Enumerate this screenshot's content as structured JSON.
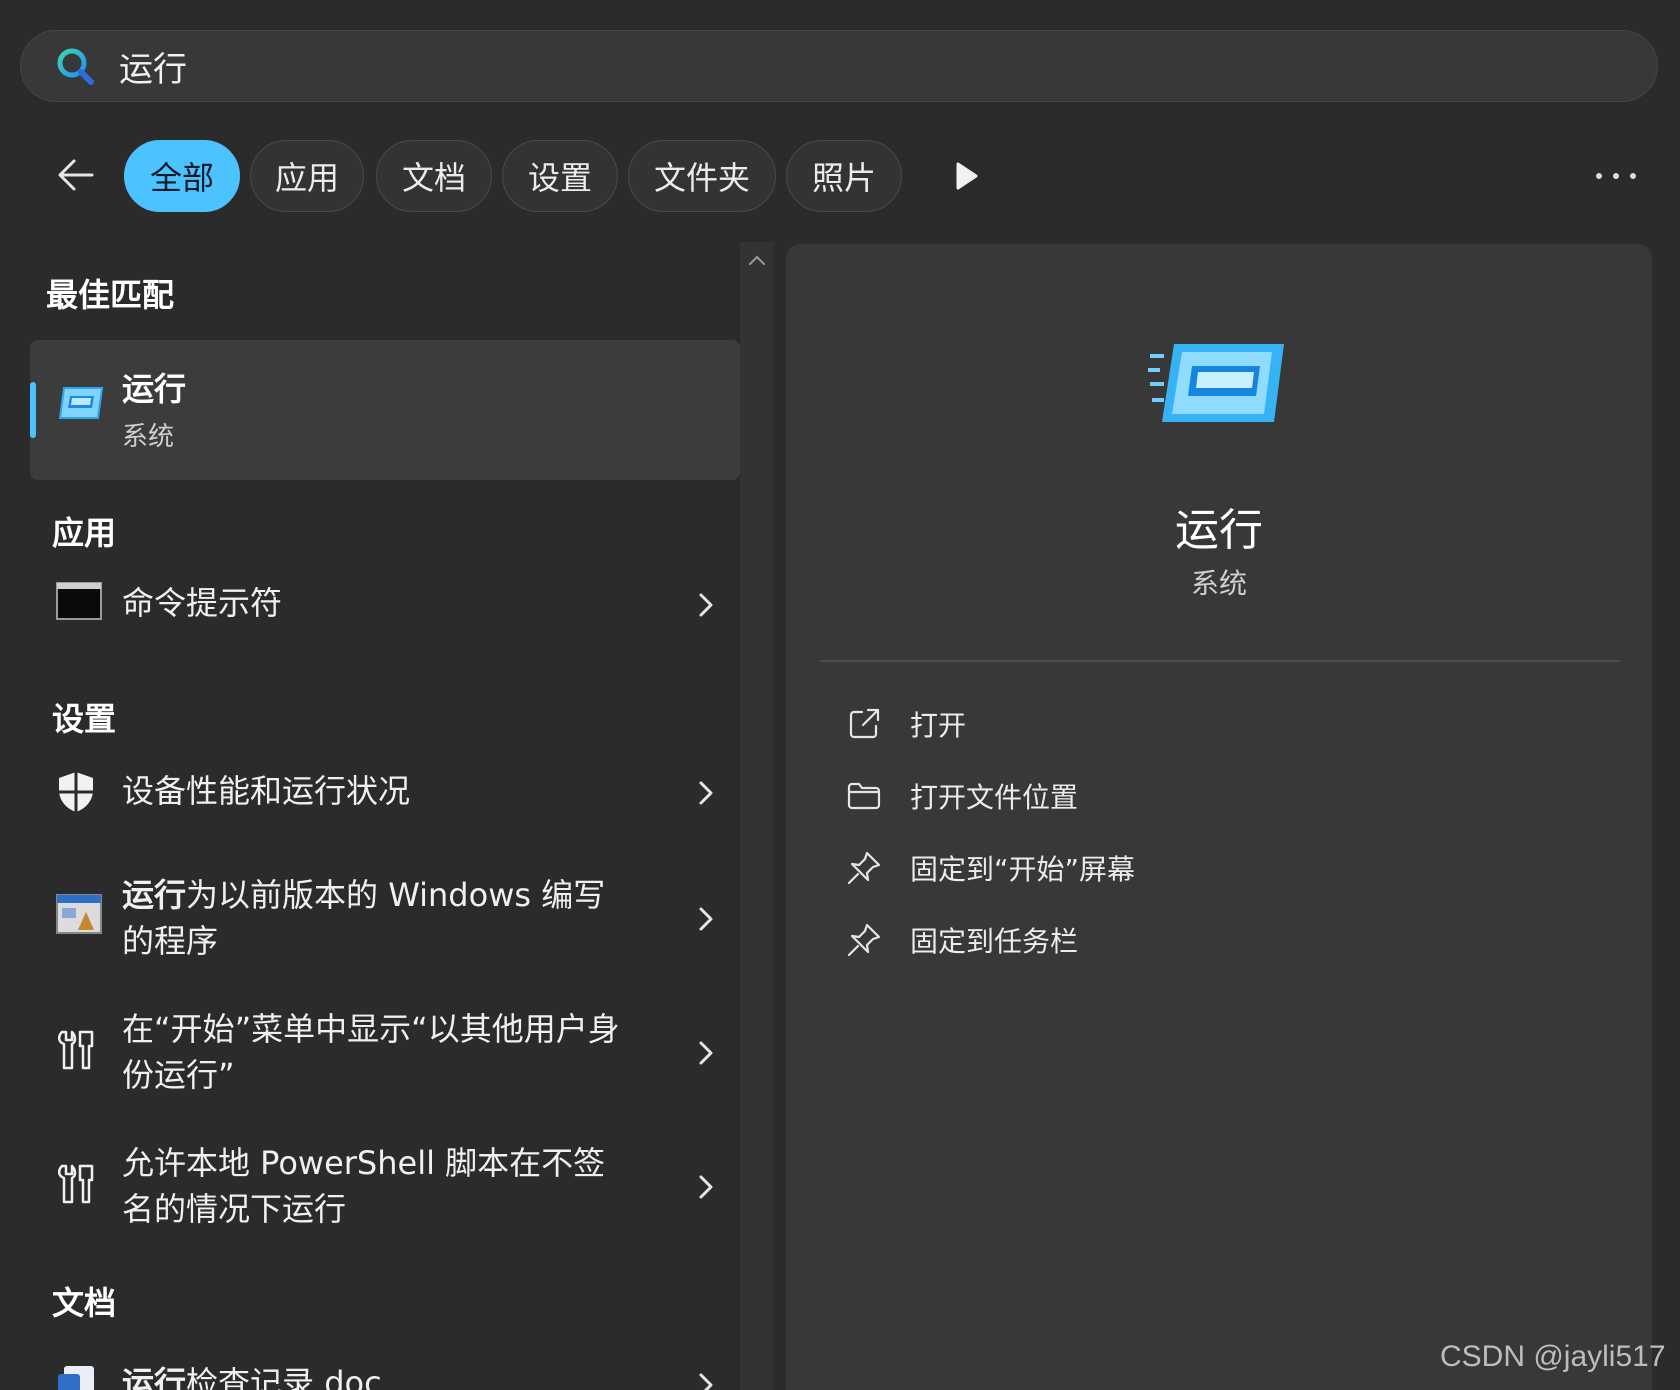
{
  "search": {
    "query": "运行"
  },
  "tabs": [
    {
      "label": "全部",
      "active": true
    },
    {
      "label": "应用",
      "active": false
    },
    {
      "label": "文档",
      "active": false
    },
    {
      "label": "设置",
      "active": false
    },
    {
      "label": "文件夹",
      "active": false
    },
    {
      "label": "照片",
      "active": false
    }
  ],
  "sections": {
    "best_match": "最佳匹配",
    "apps": "应用",
    "settings": "设置",
    "docs": "文档"
  },
  "best_match": {
    "title": "运行",
    "subtitle": "系统",
    "icon": "run-dialog-icon"
  },
  "apps": [
    {
      "label": "命令提示符",
      "icon": "command-prompt-icon"
    }
  ],
  "settings": [
    {
      "label": "设备性能和运行状况",
      "icon": "shield-icon"
    },
    {
      "label_bold": "运行",
      "label_rest": "为以前版本的 Windows 编写的程序",
      "icon": "compatibility-icon"
    },
    {
      "label": "在“开始”菜单中显示“以其他用户身份运行”",
      "icon": "developer-tools-icon"
    },
    {
      "label": "允许本地 PowerShell 脚本在不签名的情况下运行",
      "icon": "developer-tools-icon"
    }
  ],
  "docs": [
    {
      "label_bold": "运行",
      "label_rest": "检查记录.doc",
      "icon": "word-doc-icon"
    }
  ],
  "detail": {
    "title": "运行",
    "subtitle": "系统",
    "actions": [
      {
        "label": "打开",
        "icon": "open-external-icon"
      },
      {
        "label": "打开文件位置",
        "icon": "folder-icon"
      },
      {
        "label": "固定到“开始”屏幕",
        "icon": "pin-icon"
      },
      {
        "label": "固定到任务栏",
        "icon": "pin-icon"
      }
    ]
  },
  "watermark": "CSDN @jayli517",
  "colors": {
    "accent": "#4cc2ff",
    "background": "#2b2b2b",
    "panel": "#383838"
  }
}
